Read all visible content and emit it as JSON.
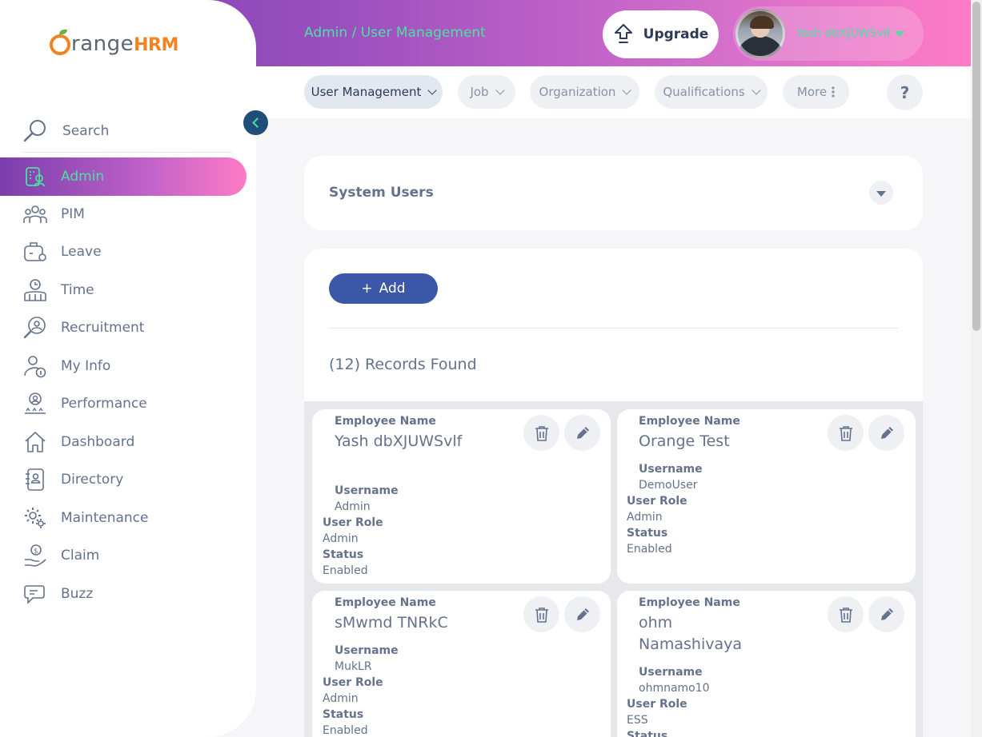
{
  "header": {
    "breadcrumb": "Admin / User Management",
    "upgrade_label": "Upgrade",
    "user_name": "Yash dbXJUWSvlf"
  },
  "topnav": {
    "tabs": [
      {
        "label": "User Management",
        "active": true
      },
      {
        "label": "Job"
      },
      {
        "label": "Organization"
      },
      {
        "label": "Qualifications"
      },
      {
        "label": "More"
      }
    ],
    "help_label": "?"
  },
  "sidebar": {
    "logo_text": "range",
    "logo_suffix": "HRM",
    "search_label": "Search",
    "items": [
      {
        "label": "Admin",
        "icon": "admin-icon",
        "active": true
      },
      {
        "label": "PIM",
        "icon": "pim-icon"
      },
      {
        "label": "Leave",
        "icon": "leave-icon"
      },
      {
        "label": "Time",
        "icon": "time-icon"
      },
      {
        "label": "Recruitment",
        "icon": "recruitment-icon"
      },
      {
        "label": "My Info",
        "icon": "my-info-icon"
      },
      {
        "label": "Performance",
        "icon": "performance-icon"
      },
      {
        "label": "Dashboard",
        "icon": "dashboard-icon"
      },
      {
        "label": "Directory",
        "icon": "directory-icon"
      },
      {
        "label": "Maintenance",
        "icon": "maintenance-icon"
      },
      {
        "label": "Claim",
        "icon": "claim-icon"
      },
      {
        "label": "Buzz",
        "icon": "buzz-icon"
      }
    ]
  },
  "system_users": {
    "title": "System Users"
  },
  "list": {
    "add_label": "Add",
    "records_found": "(12) Records Found",
    "labels": {
      "employee_name": "Employee Name",
      "username": "Username",
      "user_role": "User Role",
      "status": "Status"
    },
    "users": [
      {
        "employee_name": "Yash dbXJUWSvlf",
        "username": "Admin",
        "user_role": "Admin",
        "status": "Enabled"
      },
      {
        "employee_name": "Orange Test",
        "username": "DemoUser",
        "user_role": "Admin",
        "status": "Enabled"
      },
      {
        "employee_name": "sMwmd TNRkC",
        "username": "MukLR",
        "user_role": "Admin",
        "status": "Enabled"
      },
      {
        "employee_name": "ohm Namashivaya",
        "username": "ohmnamo10",
        "user_role": "ESS",
        "status": "Status"
      }
    ]
  },
  "colors": {
    "accent_green": "#4ce0a0",
    "primary_blue": "#3a57a8",
    "logo_orange": "#f58220"
  }
}
